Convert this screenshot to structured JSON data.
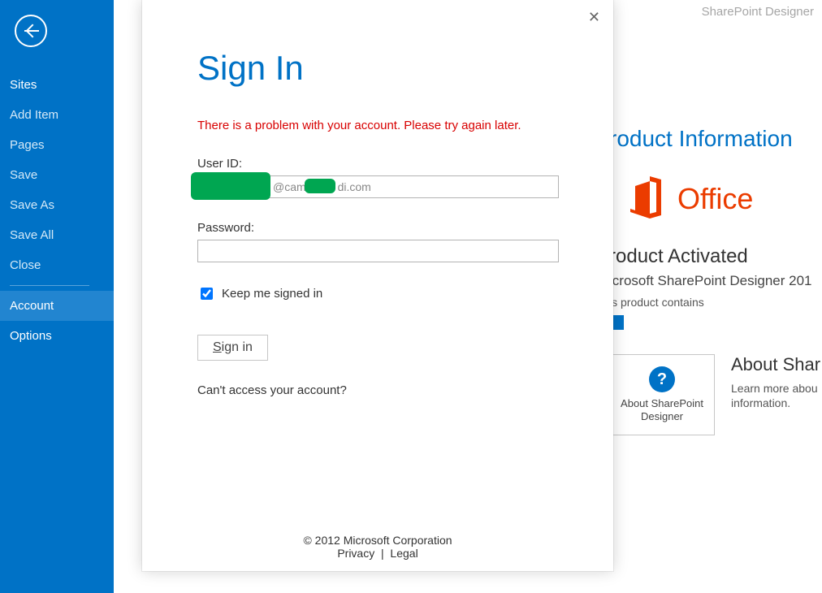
{
  "app_name": "SharePoint Designer",
  "sidebar": {
    "items": [
      {
        "label": "Sites",
        "strong": true
      },
      {
        "label": "Add Item"
      },
      {
        "label": "Pages"
      },
      {
        "label": "Save"
      },
      {
        "label": "Save As"
      },
      {
        "label": "Save All"
      },
      {
        "label": "Close"
      }
    ],
    "account_label": "Account",
    "options_label": "Options"
  },
  "product": {
    "title_suffix": "roduct Information",
    "brand": "Office",
    "activated_suffix": "roduct Activated",
    "name_suffix": "icrosoft SharePoint Designer 201",
    "contains_suffix": "is product contains",
    "about_box_label": "About SharePoint Designer",
    "about_heading": "About Shar",
    "about_desc_l1": "Learn more abou",
    "about_desc_l2": "information."
  },
  "dialog": {
    "title": "Sign In",
    "error": "There is a problem with your account. Please try again later.",
    "userid_label": "User ID:",
    "userid_value_visible": "@came        di.com",
    "password_label": "Password:",
    "keep_signed_in": "Keep me signed in",
    "signin_button_rest": "ign in",
    "cant_access": "Can't access your account?",
    "copyright": "© 2012 Microsoft Corporation",
    "privacy": "Privacy",
    "legal": "Legal"
  }
}
